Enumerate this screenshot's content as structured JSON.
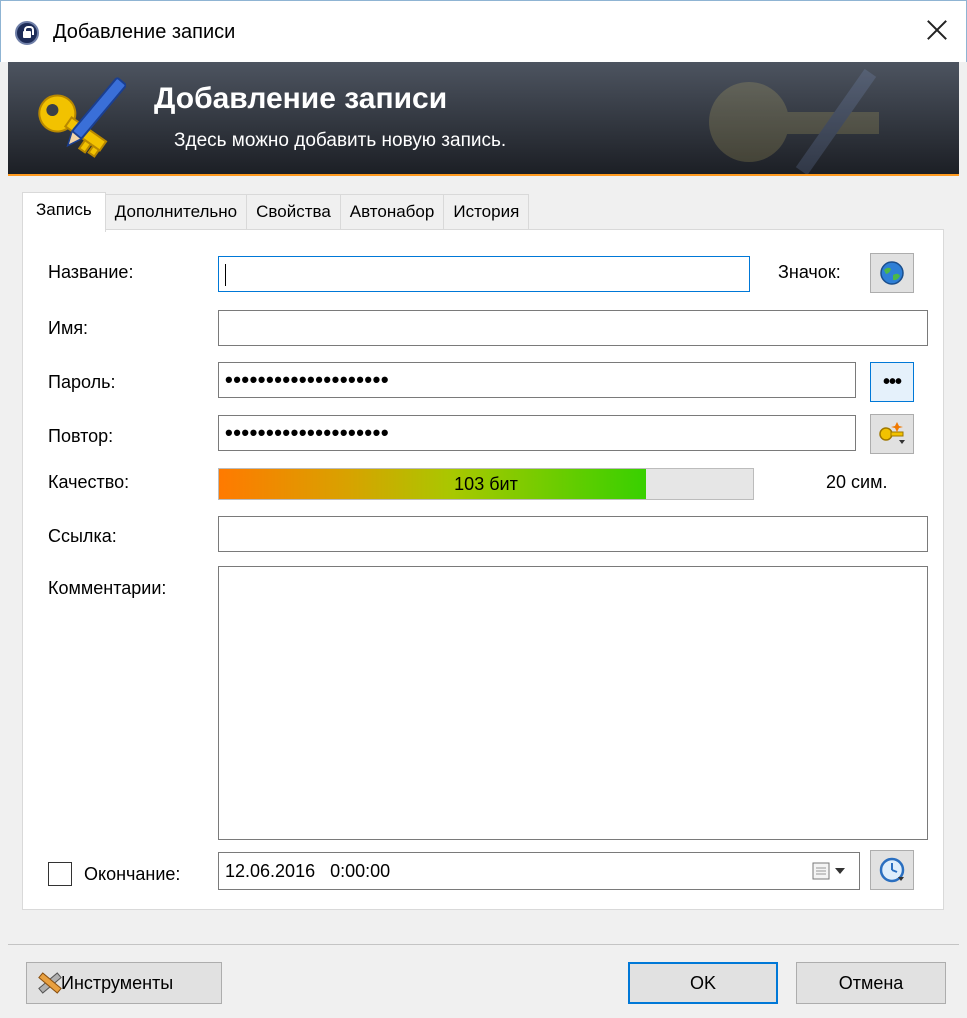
{
  "window": {
    "title": "Добавление записи"
  },
  "banner": {
    "title": "Добавление записи",
    "subtitle": "Здесь можно добавить новую запись."
  },
  "tabs": [
    "Запись",
    "Дополнительно",
    "Свойства",
    "Автонабор",
    "История"
  ],
  "form": {
    "title_label": "Название:",
    "title_value": "",
    "icon_label": "Значок:",
    "user_label": "Имя:",
    "user_value": "",
    "password_label": "Пароль:",
    "password_value": "••••••••••••••••••••",
    "repeat_label": "Повтор:",
    "repeat_value": "••••••••••••••••••••",
    "show_password_button": "•••",
    "quality_label": "Качество:",
    "quality_text": "103 бит",
    "quality_fraction": 0.8,
    "length_text": "20 сим.",
    "url_label": "Ссылка:",
    "url_value": "",
    "notes_label": "Комментарии:",
    "notes_value": "",
    "expires_label": "Окончание:",
    "expires_checked": false,
    "expires_value": "12.06.2016   0:00:00"
  },
  "footer": {
    "tools_button": "Инструменты",
    "ok_button": "OK",
    "cancel_button": "Отмена"
  },
  "colors": {
    "accent": "#0078d7",
    "banner_line": "#ff9a1f",
    "quality_start": "#ff7a00",
    "quality_end": "#38d000"
  },
  "icons": [
    "lock-icon",
    "key-pen-icon",
    "globe-icon",
    "password-generator-icon",
    "calendar-icon",
    "clock-icon",
    "tools-icon",
    "close-icon"
  ]
}
